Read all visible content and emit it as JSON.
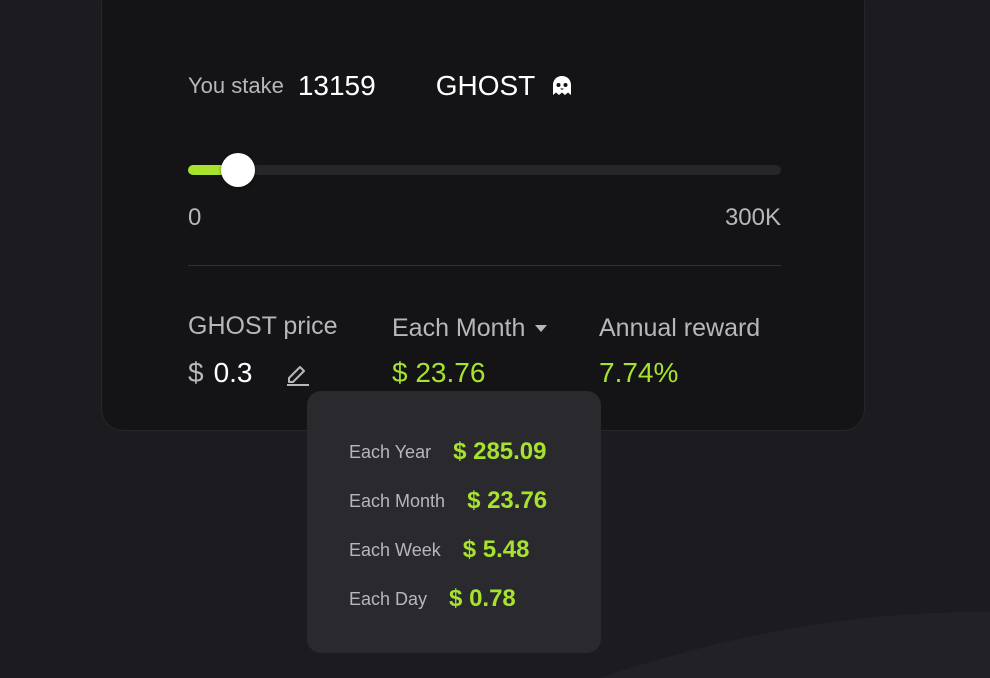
{
  "stake": {
    "label": "You stake",
    "amount": "13159",
    "token": "GHOST",
    "token_icon": "ghost-icon"
  },
  "slider": {
    "min_label": "0",
    "max_label": "300K",
    "value": 13159,
    "max": 300000
  },
  "price": {
    "label": "GHOST price",
    "currency": "$",
    "value": "0.3",
    "edit_icon": "pencil-icon"
  },
  "period": {
    "selected": "Each Month",
    "value": "$ 23.76"
  },
  "annual": {
    "label": "Annual reward",
    "value": "7.74%"
  },
  "dropdown": {
    "items": [
      {
        "label": "Each Year",
        "value": "$ 285.09"
      },
      {
        "label": "Each Month",
        "value": "$ 23.76"
      },
      {
        "label": "Each Week",
        "value": "$ 5.48"
      },
      {
        "label": "Each Day",
        "value": "$ 0.78"
      }
    ]
  },
  "colors": {
    "accent": "#a6e22e",
    "background": "#1c1c20",
    "card": "#141417",
    "dropdown": "#29292e",
    "muted_text": "#b6b6bd"
  }
}
